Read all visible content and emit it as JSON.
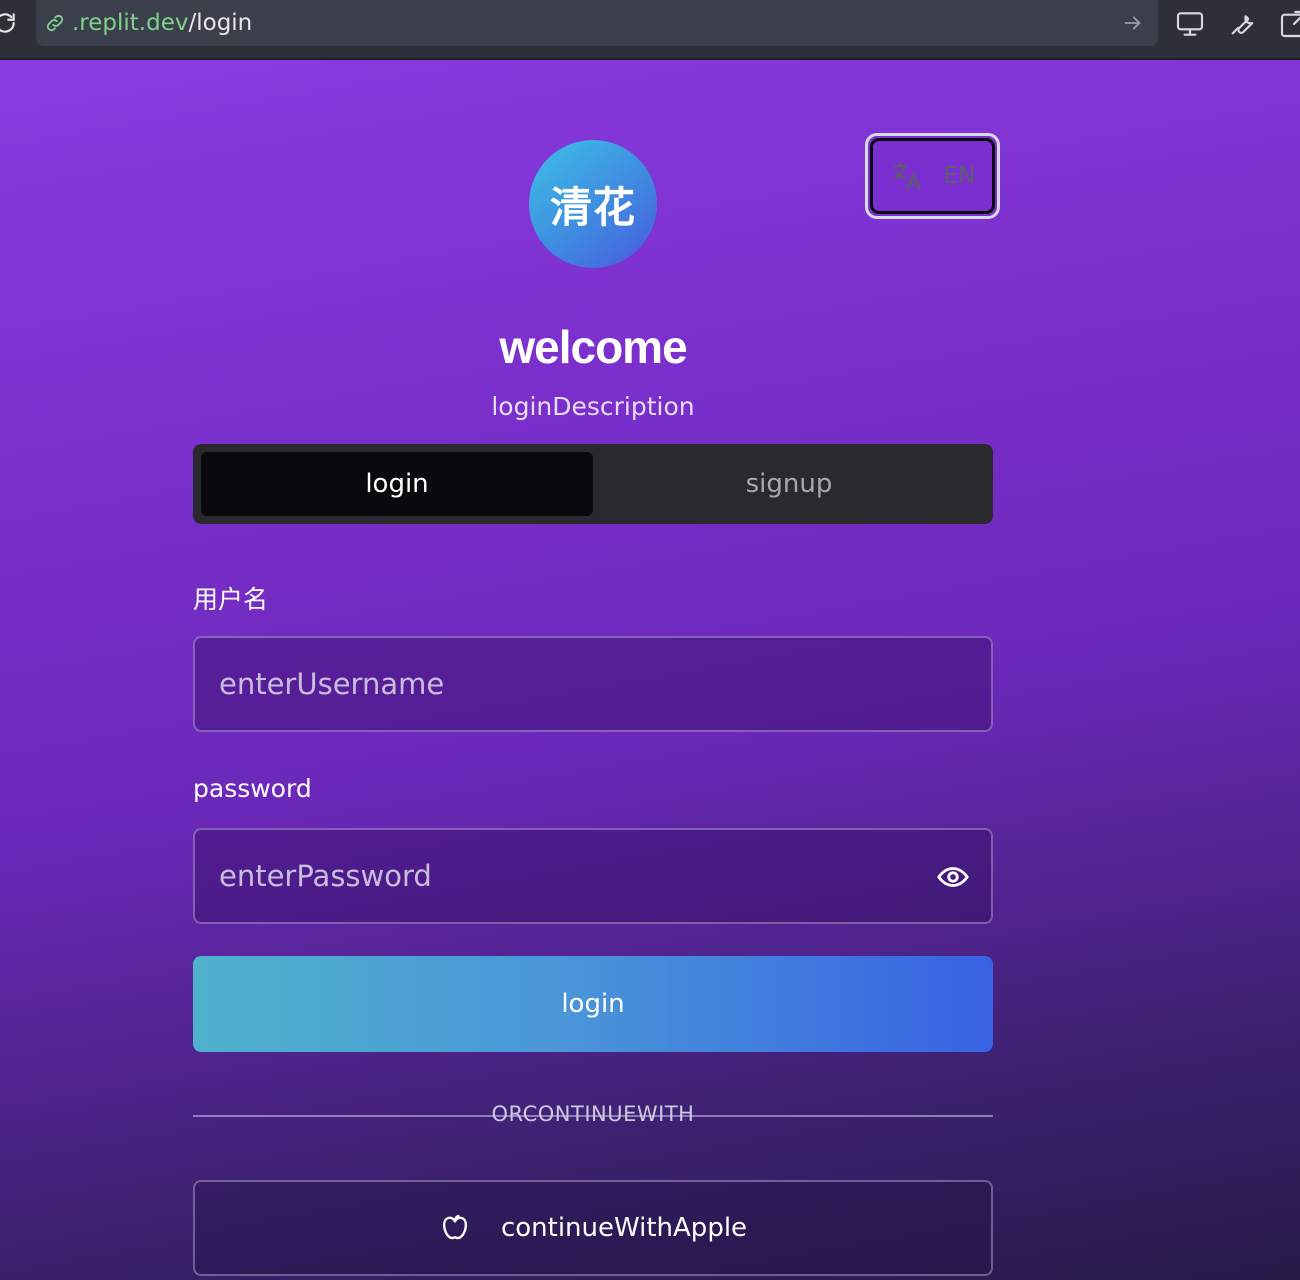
{
  "browser": {
    "url_host": ".replit.dev",
    "url_path": "/login",
    "icons": [
      "reload-icon",
      "link-icon",
      "go-arrow-icon",
      "monitor-icon",
      "wrench-icon",
      "open-external-icon"
    ]
  },
  "header": {
    "logo_text": "清花",
    "language_label": "EN",
    "language_icon": "translate-icon"
  },
  "main": {
    "title": "welcome",
    "subtitle": "loginDescription",
    "tabs": [
      {
        "label": "login",
        "active": true
      },
      {
        "label": "signup",
        "active": false
      }
    ]
  },
  "form": {
    "username_label": "用户名",
    "username_placeholder": "enterUsername",
    "password_label": "password",
    "password_placeholder": "enterPassword",
    "password_toggle_icon": "eye-icon",
    "submit_label": "login",
    "divider_text": "ORCONTINUEWITH",
    "apple_label": "continueWithApple",
    "apple_icon": "apple-icon"
  },
  "colors": {
    "background_top": "#8a3be0",
    "background_bottom": "#271a48",
    "button_gradient_start": "#4fb2cc",
    "button_gradient_end": "#3862e3",
    "tab_active": "#0a0a0c"
  }
}
